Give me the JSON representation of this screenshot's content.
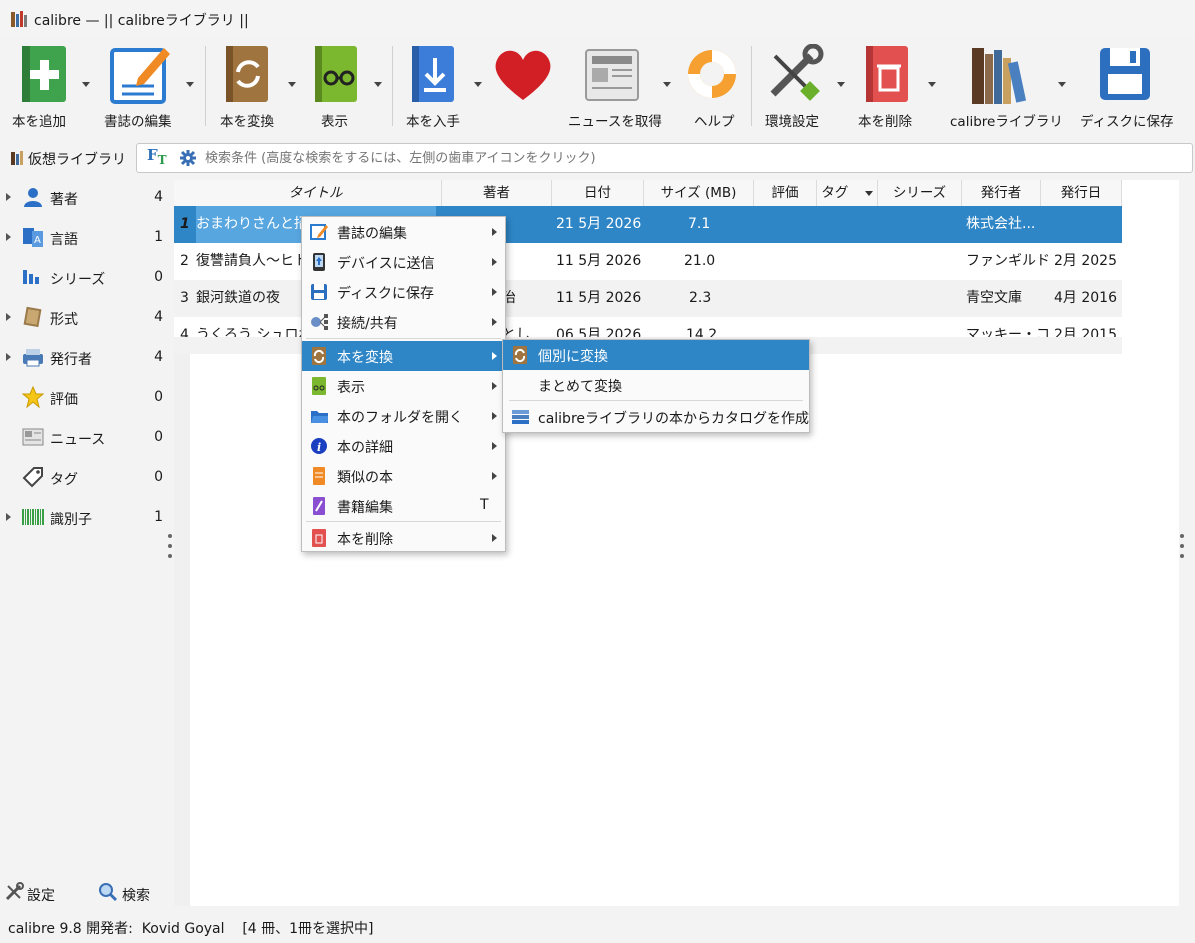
{
  "window": {
    "title": "calibre — || calibreライブラリ ||"
  },
  "toolbar": {
    "add_books": "本を追加",
    "edit_metadata": "書誌の編集",
    "convert_books": "本を変換",
    "view": "表示",
    "get_books": "本を入手",
    "donate": "",
    "fetch_news": "ニュースを取得",
    "help": "ヘルプ",
    "preferences": "環境設定",
    "remove_books": "本を削除",
    "library": "calibreライブラリ",
    "save_to_disk": "ディスクに保存"
  },
  "search": {
    "virtual_library": "仮想ライブラリ",
    "placeholder": "検索条件 (高度な検索をするには、左側の歯車アイコンをクリック)"
  },
  "tag_browser": {
    "items": [
      {
        "label": "著者",
        "count": "4"
      },
      {
        "label": "言語",
        "count": "1"
      },
      {
        "label": "シリーズ",
        "count": "0"
      },
      {
        "label": "形式",
        "count": "4"
      },
      {
        "label": "発行者",
        "count": "4"
      },
      {
        "label": "評価",
        "count": "0"
      },
      {
        "label": "ニュース",
        "count": "0"
      },
      {
        "label": "タグ",
        "count": "0"
      },
      {
        "label": "識別子",
        "count": "1"
      }
    ],
    "configure": "設定",
    "find": "検索"
  },
  "table": {
    "columns": [
      "タイトル",
      "著者",
      "日付",
      "サイズ (MB)",
      "評価",
      "タグ",
      "シリーズ",
      "発行者",
      "発行日"
    ],
    "rows": [
      {
        "num": "1",
        "title": "おまわりさんと招き",
        "author": "",
        "date": "21  5月 2026",
        "size": "7.1",
        "publisher": "株式会社...",
        "pubdate": ""
      },
      {
        "num": "2",
        "title": "復讐請負人〜ヒト",
        "author": "",
        "date": "11  5月 2026",
        "size": "21.0",
        "publisher": "ファンギルド",
        "pubdate": "2月 2025"
      },
      {
        "num": "3",
        "title": "銀河鉄道の夜",
        "author": "治",
        "date": "11  5月 2026",
        "size": "2.3",
        "publisher": "青空文庫",
        "pubdate": "4月 2016"
      },
      {
        "num": "4",
        "title": "うくろう シュロわたし",
        "author": "とし",
        "date": "06  5月 2026",
        "size": "14.2",
        "publisher": "マッキー・コ...",
        "pubdate": "2月 2015"
      }
    ]
  },
  "context_menu": {
    "items": [
      "書誌の編集",
      "デバイスに送信",
      "ディスクに保存",
      "接続/共有",
      "本を変換",
      "表示",
      "本のフォルダを開く",
      "本の詳細",
      "類似の本",
      "書籍編集",
      "本を削除"
    ],
    "shortcut_edit_book": "T",
    "submenu": [
      "個別に変換",
      "まとめて変換",
      "calibreライブラリの本からカタログを作成"
    ]
  },
  "status": {
    "text": "calibre 9.8 開発者:  Kovid Goyal    [4 冊、1冊を選択中]"
  }
}
